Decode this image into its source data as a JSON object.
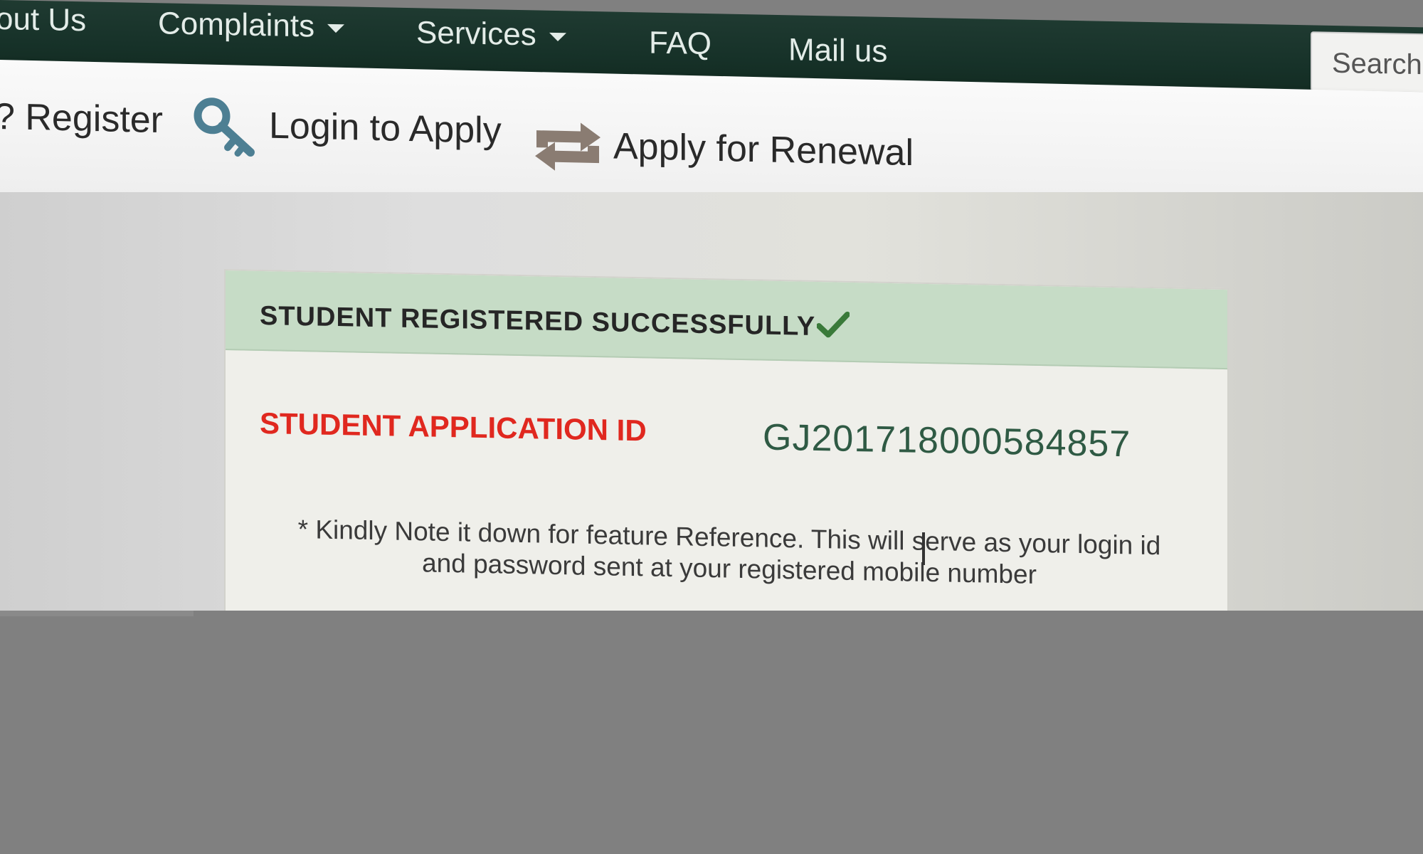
{
  "nav": {
    "items": [
      {
        "label": "out Us",
        "has_caret": false
      },
      {
        "label": "Complaints",
        "has_caret": true
      },
      {
        "label": "Services",
        "has_caret": true
      },
      {
        "label": "FAQ",
        "has_caret": false
      },
      {
        "label": "Mail us",
        "has_caret": false
      }
    ],
    "search_placeholder": "Search."
  },
  "toolbar": {
    "register_label": "? Register",
    "login_label": "Login to Apply",
    "login_icon": "key-icon",
    "renewal_label": "Apply for Renewal",
    "renewal_icon": "repeat-arrows-icon"
  },
  "panel": {
    "title": "STUDENT REGISTERED SUCCESSFULLY",
    "title_icon": "checkmark-icon",
    "app_id_label": "STUDENT APPLICATION ID",
    "app_id_value": "GJ201718000584857",
    "note_line1": "* Kindly Note it down for feature Reference. This will serve as your login id",
    "note_line2": "and password sent at your registered mobile number"
  },
  "colors": {
    "nav_bg": "#163128",
    "header_green": "#c6dcc6",
    "label_red": "#e0281f",
    "id_green": "#2f5a44"
  }
}
